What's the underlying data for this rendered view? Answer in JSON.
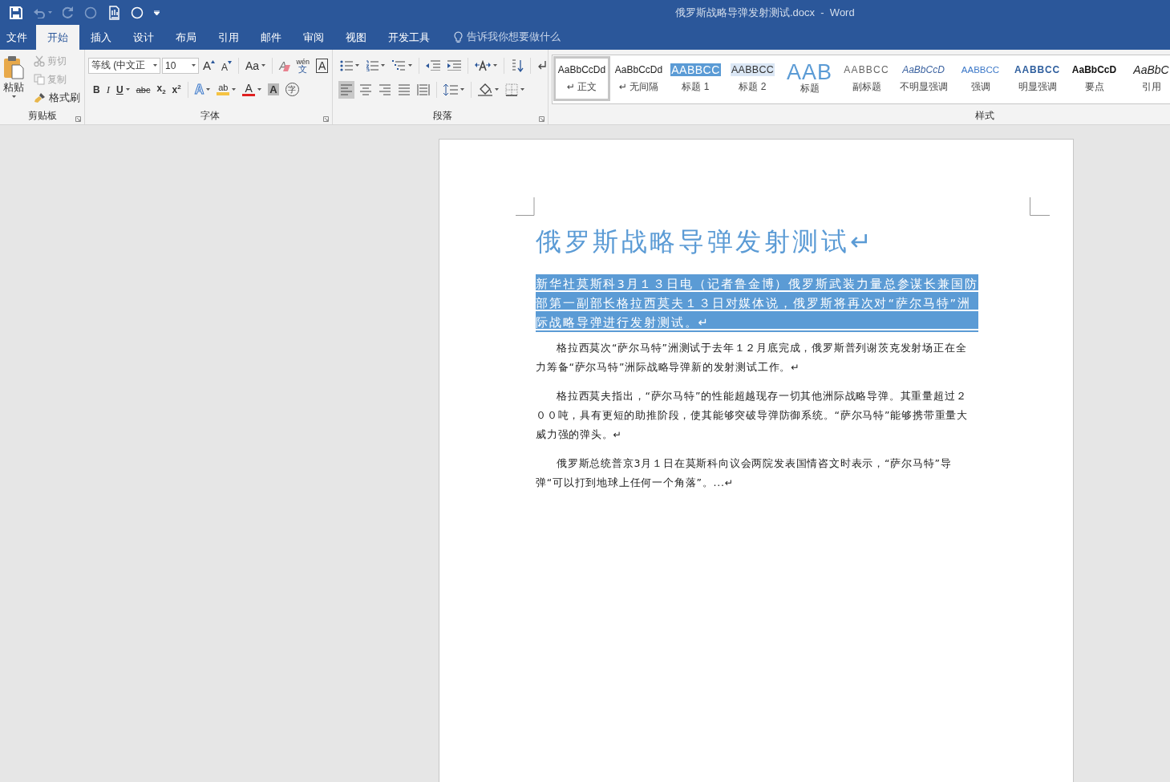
{
  "window": {
    "title": "俄罗斯战略导弹发射测试.docx  -  Word"
  },
  "tabs": [
    {
      "label": "文件",
      "selected": false
    },
    {
      "label": "开始",
      "selected": true
    },
    {
      "label": "插入",
      "selected": false
    },
    {
      "label": "设计",
      "selected": false
    },
    {
      "label": "布局",
      "selected": false
    },
    {
      "label": "引用",
      "selected": false
    },
    {
      "label": "邮件",
      "selected": false
    },
    {
      "label": "审阅",
      "selected": false
    },
    {
      "label": "视图",
      "selected": false
    },
    {
      "label": "开发工具",
      "selected": false
    }
  ],
  "tell_me": {
    "placeholder": "告诉我你想要做什么"
  },
  "clipboard": {
    "label": "剪贴板",
    "paste": "粘贴",
    "buttons": [
      {
        "kind": "cut",
        "label": "剪切",
        "disabled": true
      },
      {
        "kind": "copy",
        "label": "复制",
        "disabled": true
      },
      {
        "kind": "painter",
        "label": "格式刷",
        "disabled": false
      }
    ]
  },
  "font": {
    "label": "字体",
    "font_name": "等线 (中文正",
    "font_size": "10",
    "row1": [
      {
        "kind": "grow",
        "label": "A"
      },
      {
        "kind": "shrink",
        "label": "A"
      },
      {
        "kind": "case",
        "label": "Aa"
      },
      {
        "kind": "clear",
        "label": "A"
      },
      {
        "kind": "phonetic",
        "label": "文",
        "ruby": "wén"
      },
      {
        "kind": "border",
        "label": "A"
      }
    ],
    "row2": [
      {
        "kind": "bold",
        "label": "B"
      },
      {
        "kind": "italic",
        "label": "I"
      },
      {
        "kind": "underline",
        "label": "U"
      },
      {
        "kind": "strike",
        "label": "abc"
      },
      {
        "kind": "sub",
        "label": "x$_{2}$"
      },
      {
        "kind": "sup",
        "label": "x$^{2}$"
      },
      {
        "kind": "effects",
        "label": "A"
      },
      {
        "kind": "highlight",
        "label": "ab"
      },
      {
        "kind": "color",
        "label": "A"
      },
      {
        "kind": "shading",
        "label": "A"
      },
      {
        "kind": "enclose",
        "label": "字"
      }
    ]
  },
  "paragraph": {
    "label": "段落",
    "alignment": [
      {
        "kind": "left",
        "selected": true
      },
      {
        "kind": "center",
        "selected": false
      },
      {
        "kind": "right",
        "selected": false
      },
      {
        "kind": "justify",
        "selected": false
      },
      {
        "kind": "distributed",
        "selected": false
      }
    ]
  },
  "styles": {
    "label": "样式",
    "items": [
      {
        "kind": "normal",
        "sample": "AaBbCcDd",
        "label": "↵ 正文",
        "selected": true
      },
      {
        "kind": "nospacing",
        "sample": "AaBbCcDd",
        "label": "↵ 无间隔",
        "selected": false
      },
      {
        "kind": "heading1",
        "sample": "AABBCC",
        "label": "标题 1",
        "selected": false
      },
      {
        "kind": "heading2",
        "sample": "AABBCC",
        "label": "标题 2",
        "selected": false
      },
      {
        "kind": "title",
        "sample": "AAB",
        "label": "标题",
        "selected": false
      },
      {
        "kind": "subtitle",
        "sample": "AABBCC",
        "label": "副标题",
        "selected": false
      },
      {
        "kind": "subtle",
        "sample": "AaBbCcD",
        "label": "不明显强调",
        "selected": false
      },
      {
        "kind": "emphasis",
        "sample": "AABBCC",
        "label": "强调",
        "selected": false
      },
      {
        "kind": "intense",
        "sample": "AABBCC",
        "label": "明显强调",
        "selected": false
      },
      {
        "kind": "strong",
        "sample": "AaBbCcD",
        "label": "要点",
        "selected": false
      },
      {
        "kind": "quote",
        "sample": "AaBbC",
        "label": "引用",
        "selected": false
      }
    ]
  },
  "document": {
    "title": {
      "text": "俄罗斯战略导弹发射测试↵"
    },
    "paragraphs": [
      {
        "text": "新华社莫斯科3月１３日电（记者鲁金博）俄罗斯武装力量总参谋长兼国防部第一副部长格拉西莫夫１３日对媒体说，俄罗斯将再次对“萨尔马特”洲际战略导弹进行发射测试。↵",
        "selected": true
      },
      {
        "text": "格拉西莫次“萨尔马特”洲测试于去年１２月底完成，俄罗斯普列谢茨克发射场正在全力筹备“萨尔马特”洲际战略导弹新的发射测试工作。↵",
        "selected": false
      },
      {
        "text": "格拉西莫夫指出，“萨尔马特”的性能超越现存一切其他洲际战略导弹。其重量超过２００吨，具有更短的助推阶段，使其能够突破导弹防御系统。“萨尔马特”能够携带重量大威力强的弹头。↵",
        "selected": false
      },
      {
        "text": "俄罗斯总统普京3月１日在莫斯科向议会两院发表国情咨文时表示，“萨尔马特”导弹“可以打到地球上任何一个角落”。...↵",
        "selected": false
      }
    ]
  }
}
